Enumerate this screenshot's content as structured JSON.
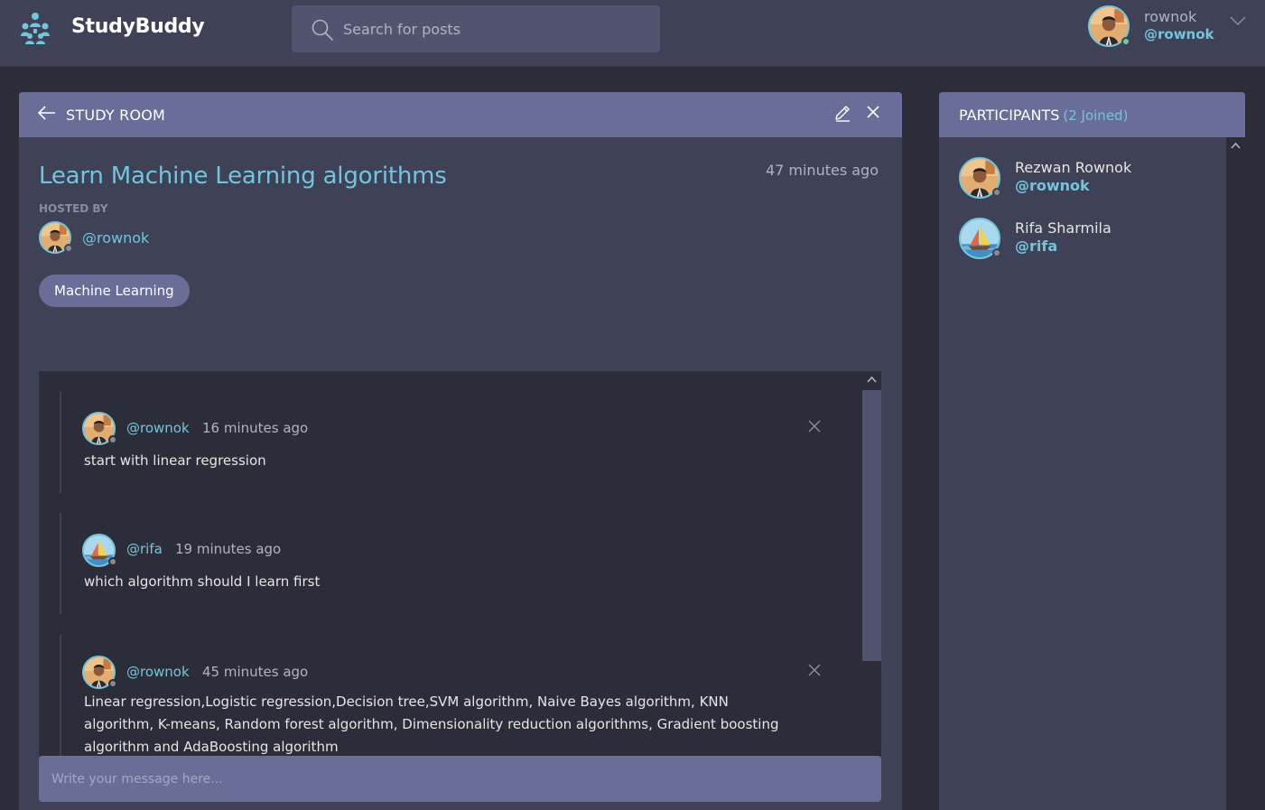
{
  "brand": {
    "name": "StudyBuddy"
  },
  "search": {
    "placeholder": "Search for posts"
  },
  "current_user": {
    "name": "rownok",
    "handle": "@rownok",
    "status": "online"
  },
  "room": {
    "header_title": "STUDY ROOM",
    "title": "Learn Machine Learning algorithms",
    "created": "47 minutes ago",
    "hosted_by_label": "HOSTED BY",
    "host_handle": "@rownok",
    "topic": "Machine Learning"
  },
  "messages": [
    {
      "handle": "@rownok",
      "time": "16 minutes ago",
      "body": "start with linear regression",
      "deletable": true
    },
    {
      "handle": "@rifa",
      "time": "19 minutes ago",
      "body": "which algorithm should I learn first",
      "deletable": false
    },
    {
      "handle": "@rownok",
      "time": "45 minutes ago",
      "body": "Linear regression,Logistic regression,Decision tree,SVM algorithm, Naive Bayes algorithm, KNN algorithm, K-means, Random forest algorithm, Dimensionality reduction algorithms, Gradient boosting algorithm and AdaBoosting algorithm",
      "deletable": true
    }
  ],
  "composer": {
    "placeholder": "Write your message here..."
  },
  "participants": {
    "title": "PARTICIPANTS",
    "count_label": "(2 Joined)",
    "list": [
      {
        "name": "Rezwan Rownok",
        "handle": "@rownok",
        "avatar": "portrait"
      },
      {
        "name": "Rifa Sharmila",
        "handle": "@rifa",
        "avatar": "sailboat"
      }
    ]
  },
  "colors": {
    "background": "#2d2d39",
    "panel": "#3f4156",
    "panel_header": "#696d97",
    "accent": "#71c6dd",
    "muted_text": "#b2b2c4",
    "online": "#5dd693",
    "offline": "#8b8b8b"
  }
}
